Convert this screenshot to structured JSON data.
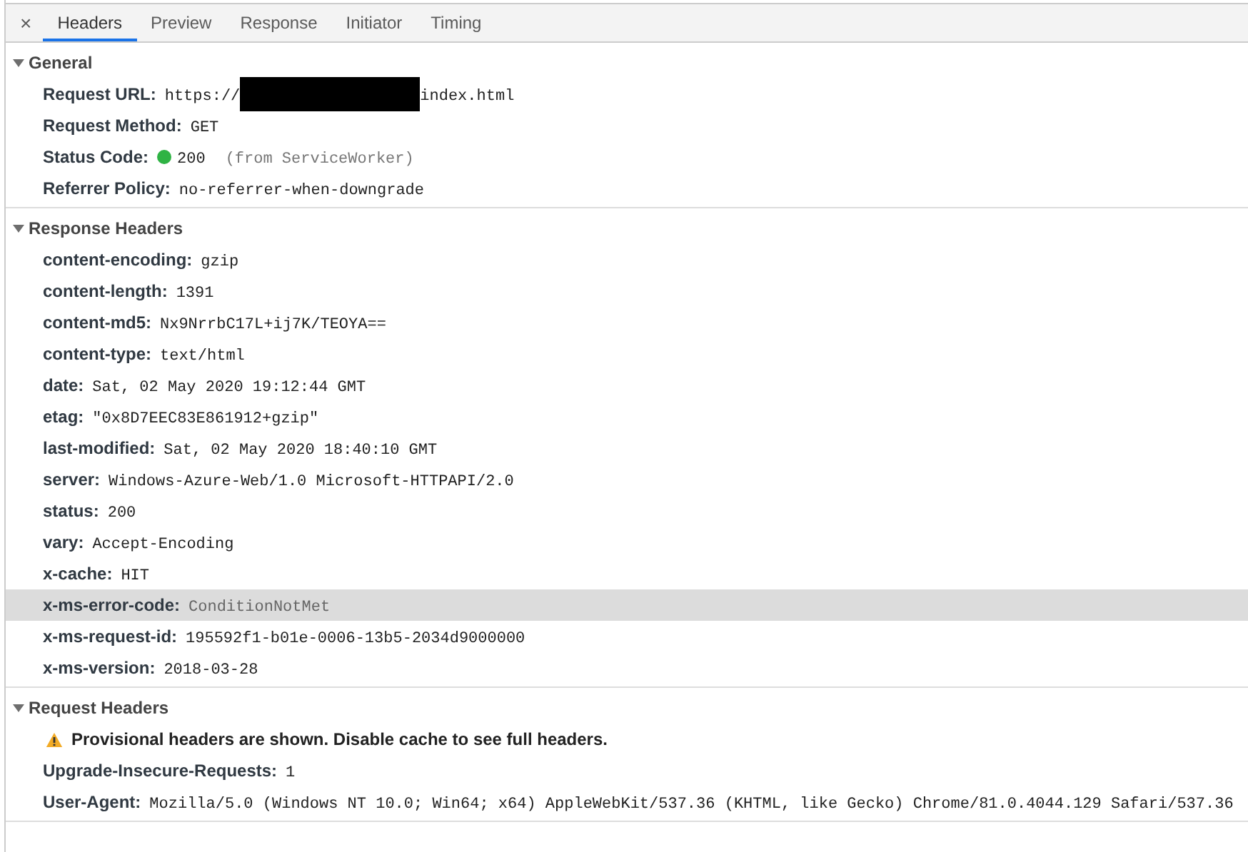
{
  "close_label": "×",
  "tabs": [
    {
      "label": "Headers",
      "selected": true
    },
    {
      "label": "Preview",
      "selected": false
    },
    {
      "label": "Response",
      "selected": false
    },
    {
      "label": "Initiator",
      "selected": false
    },
    {
      "label": "Timing",
      "selected": false
    }
  ],
  "sections": [
    {
      "title": "General",
      "expanded": true,
      "rows": [
        {
          "kind": "url",
          "name": "Request URL:",
          "value": "https://",
          "redacted": true,
          "value_after": "index.html"
        },
        {
          "kind": "plain",
          "name": "Request Method:",
          "value": "GET"
        },
        {
          "kind": "status",
          "name": "Status Code:",
          "color": "#2fb344",
          "value": "200",
          "note": "(from ServiceWorker)"
        },
        {
          "kind": "plain",
          "name": "Referrer Policy:",
          "value": "no-referrer-when-downgrade"
        }
      ]
    },
    {
      "title": "Response Headers",
      "expanded": true,
      "rows": [
        {
          "kind": "plain",
          "name": "content-encoding:",
          "value": "gzip"
        },
        {
          "kind": "plain",
          "name": "content-length:",
          "value": "1391"
        },
        {
          "kind": "plain",
          "name": "content-md5:",
          "value": "Nx9NrrbC17L+ij7K/TEOYA=="
        },
        {
          "kind": "plain",
          "name": "content-type:",
          "value": "text/html"
        },
        {
          "kind": "plain",
          "name": "date:",
          "value": "Sat, 02 May 2020 19:12:44 GMT"
        },
        {
          "kind": "plain",
          "name": "etag:",
          "value": "\"0x8D7EEC83E861912+gzip\""
        },
        {
          "kind": "plain",
          "name": "last-modified:",
          "value": "Sat, 02 May 2020 18:40:10 GMT"
        },
        {
          "kind": "plain",
          "name": "server:",
          "value": "Windows-Azure-Web/1.0 Microsoft-HTTPAPI/2.0"
        },
        {
          "kind": "plain",
          "name": "status:",
          "value": "200"
        },
        {
          "kind": "plain",
          "name": "vary:",
          "value": "Accept-Encoding"
        },
        {
          "kind": "plain",
          "name": "x-cache:",
          "value": "HIT"
        },
        {
          "kind": "plain",
          "name": "x-ms-error-code:",
          "value": "ConditionNotMet",
          "highlighted": true
        },
        {
          "kind": "plain",
          "name": "x-ms-request-id:",
          "value": "195592f1-b01e-0006-13b5-2034d9000000"
        },
        {
          "kind": "plain",
          "name": "x-ms-version:",
          "value": "2018-03-28"
        }
      ]
    },
    {
      "title": "Request Headers",
      "expanded": true,
      "rows": [
        {
          "kind": "warning",
          "text": "Provisional headers are shown. Disable cache to see full headers."
        },
        {
          "kind": "plain",
          "name": "Upgrade-Insecure-Requests:",
          "value": "1"
        },
        {
          "kind": "plain",
          "name": "User-Agent:",
          "value": "Mozilla/5.0 (Windows NT 10.0; Win64; x64) AppleWebKit/537.36 (KHTML, like Gecko) Chrome/81.0.4044.129 Safari/537.36"
        }
      ]
    }
  ]
}
